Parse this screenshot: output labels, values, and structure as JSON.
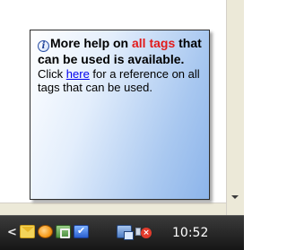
{
  "balloon": {
    "icon": "info-icon",
    "heading_part1": "More help on ",
    "heading_red": "all tags",
    "heading_part2": " that can be used is available.",
    "body_before_link": "Click ",
    "link_text": "here",
    "body_after_link": " for a reference on all tags that can be used."
  },
  "taskbar": {
    "chevron": "<",
    "tray_icons": [
      "mail-icon",
      "orange-app-icon",
      "grid-app-icon",
      "check-app-icon",
      "network-icon",
      "volume-muted-icon"
    ],
    "clock": "10:52"
  },
  "colors": {
    "accent_red": "#e21b1b",
    "link": "#0000ee",
    "taskbar": "#2a2a2a"
  }
}
